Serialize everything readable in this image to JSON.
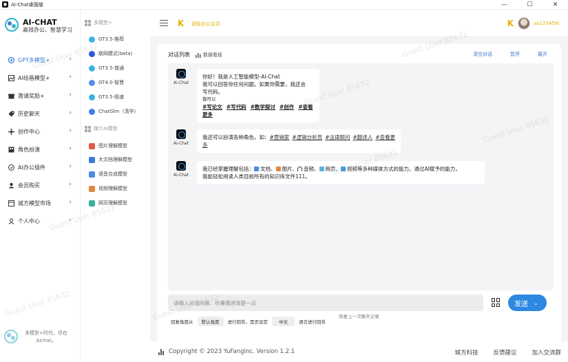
{
  "window": {
    "title": "AI-Chat桌面版",
    "controls": [
      "—",
      "☐",
      "✕"
    ]
  },
  "sidebar": {
    "logo_title": "AI-CHAT",
    "logo_subtitle": "高效办公、智慧学习",
    "items": [
      {
        "label": "GPT多模型+",
        "icon": "gpt-icon",
        "active": true
      },
      {
        "label": "AI绘画模型+",
        "icon": "image-icon"
      },
      {
        "label": "邀请奖励+",
        "icon": "gift-icon"
      },
      {
        "label": "历史聊天",
        "icon": "tag-icon"
      },
      {
        "label": "创作中心",
        "icon": "create-icon"
      },
      {
        "label": "角色扮演",
        "icon": "role-icon"
      },
      {
        "label": "AI办公插件",
        "icon": "plugin-icon"
      },
      {
        "label": "会员购买",
        "icon": "member-icon"
      },
      {
        "label": "城方模型市场",
        "icon": "market-icon"
      },
      {
        "label": "个人中心",
        "icon": "user-icon"
      }
    ],
    "footer_text": "多模型+时代，尽在AIchat。"
  },
  "models": {
    "section1": "多模型+",
    "list1": [
      {
        "label": "GT3.5-推荐",
        "color": "#3cb0e6"
      },
      {
        "label": "联网模式(beta)",
        "color": "#2a5bd7"
      },
      {
        "label": "GT3.5-普通",
        "color": "#3cb0e6"
      },
      {
        "label": "GT4.0-智慧",
        "color": "#5a8de8"
      },
      {
        "label": "GT3.5-极速",
        "color": "#3cb0e6"
      },
      {
        "label": "ChatGlm（清华）",
        "color": "#3c7ee6"
      }
    ],
    "section2": "媒介AI模型",
    "list2": [
      {
        "label": "图片理解模型",
        "color": "#e05a4a"
      },
      {
        "label": "大文档理解模型",
        "color": "#3a7bd5"
      },
      {
        "label": "语音合成模型",
        "color": "#4a8de0"
      },
      {
        "label": "视频理解模型",
        "color": "#e08a3a"
      },
      {
        "label": "网页理解模型",
        "color": "#3ab0a0"
      }
    ]
  },
  "topbar": {
    "brand_icon": "K",
    "brand_text": "获取办公会员",
    "username": "aa123456l"
  },
  "panel": {
    "title": "对话列表",
    "data_source": "数据看板",
    "actions": [
      "清空对话",
      "暂停",
      "展开"
    ],
    "bot_name": "Ai-Chat",
    "messages": [
      {
        "line1": "你好！我是人工智能模型-AI-Chat",
        "line2": "我可以回答你任何问题。如果你需要，我还会",
        "line3": "写代码。",
        "line4": "我可以",
        "tags": [
          "#写论文",
          "#写代码",
          "#数学探讨",
          "#创作",
          "#查看更多"
        ]
      },
      {
        "text": "我还可以扮演各种角色，如：",
        "links": [
          "#营销家",
          "#逻辑分析员",
          "#法律顾问",
          "#翻译人",
          "#查看更多"
        ]
      },
      {
        "prefix": "我已经掌握理解包括：",
        "media": [
          {
            "label": "文档、",
            "icon": "doc-icon"
          },
          {
            "label": "图片、",
            "icon": "picture-icon"
          },
          {
            "label": "音频、",
            "icon": "audio-icon"
          },
          {
            "label": "网页、",
            "icon": "web-icon"
          },
          {
            "label": "视频等多种媒体方式的能力。通过AI赋予的能力，",
            "icon": "video-icon"
          }
        ],
        "line2": "我能轻松阅读人类目前所有的知识库文件111。"
      }
    ],
    "restore": "恢复上一次聊天记录"
  },
  "input": {
    "placeholder": "请输入对话内容，尽量描述清楚一点",
    "send_label": "发送"
  },
  "options": {
    "perspective_label": "回复角度从",
    "perspective_value": "默认角度",
    "reply_label": "进行回答，是否设定",
    "language_value": "中文",
    "language_label": "语言进行回答"
  },
  "footer": {
    "copyright": "Copyright © 2023 YuFangInc. Version 1.2.1",
    "links": [
      "城方科技",
      "反馈建议",
      "加入交流群"
    ]
  },
  "watermark": "Guest User 85632"
}
